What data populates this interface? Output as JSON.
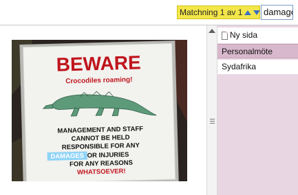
{
  "search": {
    "status": "Matchning 1 av 1",
    "value": "damage"
  },
  "pages": {
    "new_page_label": "Ny sida",
    "items": [
      "Personalmöte",
      "Sydafrika"
    ]
  },
  "sign": {
    "headline": "BEWARE",
    "subhead": "Crocodiles roaming!",
    "line1": "MANAGEMENT AND STAFF",
    "line2": "CANNOT BE HELD",
    "line3": "RESPONSIBLE FOR ANY",
    "damages": "DAMAGES",
    "line4_rest": " OR INJURIES",
    "line5": "FOR ANY REASONS",
    "line6": "WHATSOEVER!"
  },
  "colors": {
    "match_highlight": "#f3e64a",
    "search_hit": "#8fd3f7",
    "sign_red": "#c0141c",
    "selected_page": "#d7b8cc"
  }
}
